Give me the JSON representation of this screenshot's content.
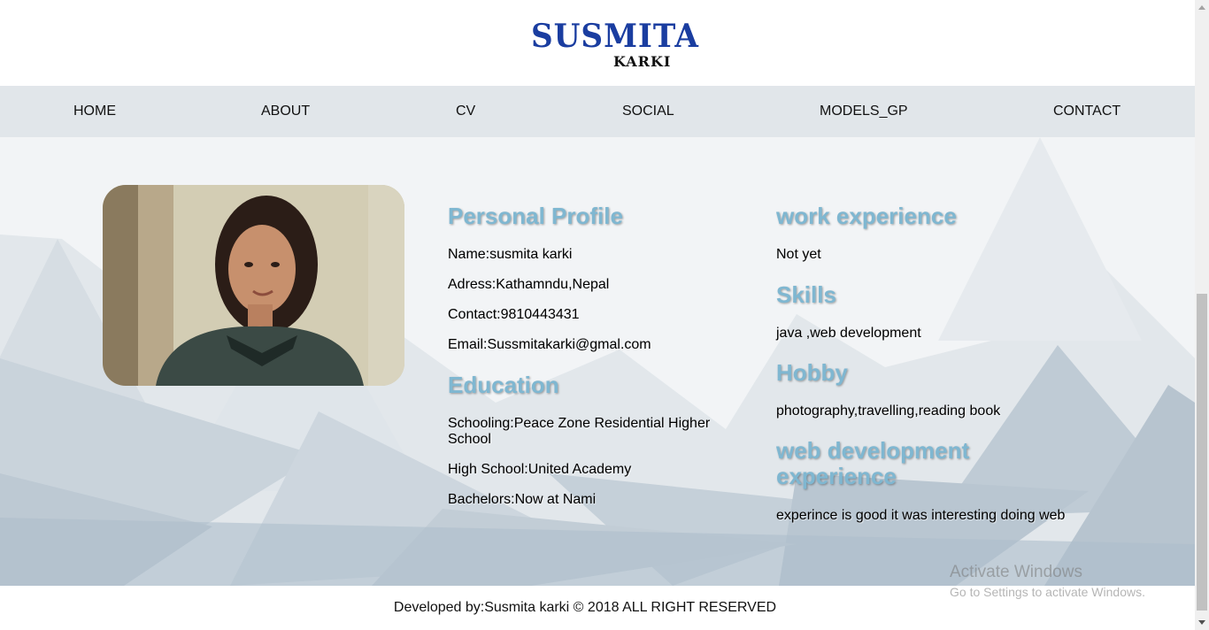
{
  "logo": {
    "main": "SUSMITA",
    "sub": "KARKI"
  },
  "nav": {
    "items": [
      {
        "label": "HOME"
      },
      {
        "label": "ABOUT"
      },
      {
        "label": "CV"
      },
      {
        "label": "SOCIAL"
      },
      {
        "label": "MODELS_GP"
      },
      {
        "label": "CONTACT"
      }
    ]
  },
  "personal_profile": {
    "heading": "Personal Profile",
    "name": "Name:susmita karki",
    "address": "Adress:Kathamndu,Nepal",
    "contact": "Contact:9810443431",
    "email": "Email:Sussmitakarki@gmal.com"
  },
  "education": {
    "heading": "Education",
    "schooling": "Schooling:Peace Zone Residential Higher School",
    "high_school": "High School:United Academy",
    "bachelors": "Bachelors:Now at Nami"
  },
  "work_experience": {
    "heading": "work experience",
    "text": "Not yet"
  },
  "skills": {
    "heading": "Skills",
    "text": "java ,web development"
  },
  "hobby": {
    "heading": "Hobby",
    "text": "photography,travelling,reading book"
  },
  "web_dev": {
    "heading": "web development experience",
    "text": "experince is good it was interesting doing web"
  },
  "footer": {
    "text": "Developed by:Susmita karki © 2018 ALL RIGHT RESERVED"
  },
  "watermark": {
    "line1": "Activate Windows",
    "line2": "Go to Settings to activate Windows."
  },
  "icons": {
    "scroll_up": "scroll-up-arrow-icon",
    "scroll_down": "scroll-down-arrow-icon"
  },
  "colors": {
    "heading": "#7fb7d1",
    "nav_bg": "#e1e6ea",
    "logo_blue": "#1a3da0"
  }
}
